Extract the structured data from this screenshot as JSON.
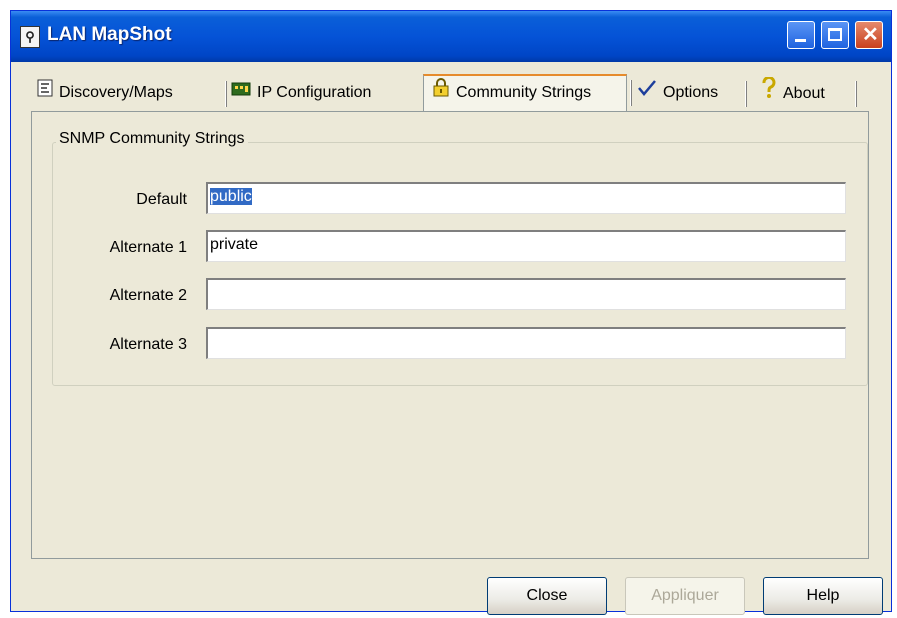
{
  "window": {
    "title": "LAN MapShot"
  },
  "tabs": [
    {
      "label": "Discovery/Maps",
      "icon": "discovery-icon"
    },
    {
      "label": "IP Configuration",
      "icon": "network-card-icon"
    },
    {
      "label": "Community Strings",
      "icon": "padlock-icon",
      "active": true
    },
    {
      "label": "Options",
      "icon": "checkmark-icon"
    },
    {
      "label": "About",
      "icon": "question-mark-icon"
    }
  ],
  "group": {
    "legend": "SNMP Community Strings",
    "rows": [
      {
        "label": "Default",
        "value": "public",
        "selected": true
      },
      {
        "label": "Alternate 1",
        "value": "private"
      },
      {
        "label": "Alternate 2",
        "value": ""
      },
      {
        "label": "Alternate 3",
        "value": ""
      }
    ]
  },
  "buttons": {
    "close": "Close",
    "apply": "Appliquer",
    "help": "Help"
  },
  "colors": {
    "titlebar": "#0553d7",
    "selection": "#316ac5",
    "active_tab_accent": "#e68b2c"
  }
}
